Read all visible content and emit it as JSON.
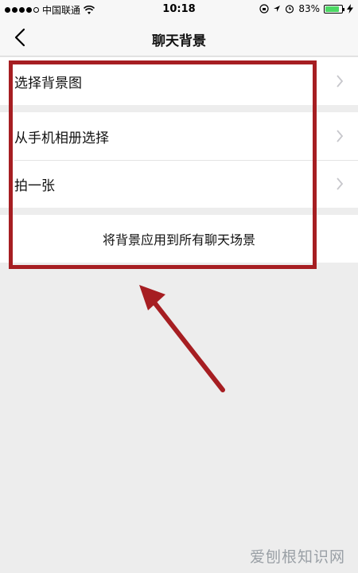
{
  "status_bar": {
    "carrier": "中国联通",
    "time": "10:18",
    "battery": "83%",
    "battery_level": 0.83
  },
  "nav": {
    "title": "聊天背景"
  },
  "groups": [
    {
      "items": [
        {
          "label": "选择背景图"
        }
      ]
    },
    {
      "items": [
        {
          "label": "从手机相册选择"
        },
        {
          "label": "拍一张"
        }
      ]
    },
    {
      "items": [
        {
          "label": "将背景应用到所有聊天场景"
        }
      ]
    }
  ],
  "annotation": {
    "box_color": "#a61e22",
    "arrow_color": "#a61e22"
  },
  "watermark": "爱刨根知识网"
}
